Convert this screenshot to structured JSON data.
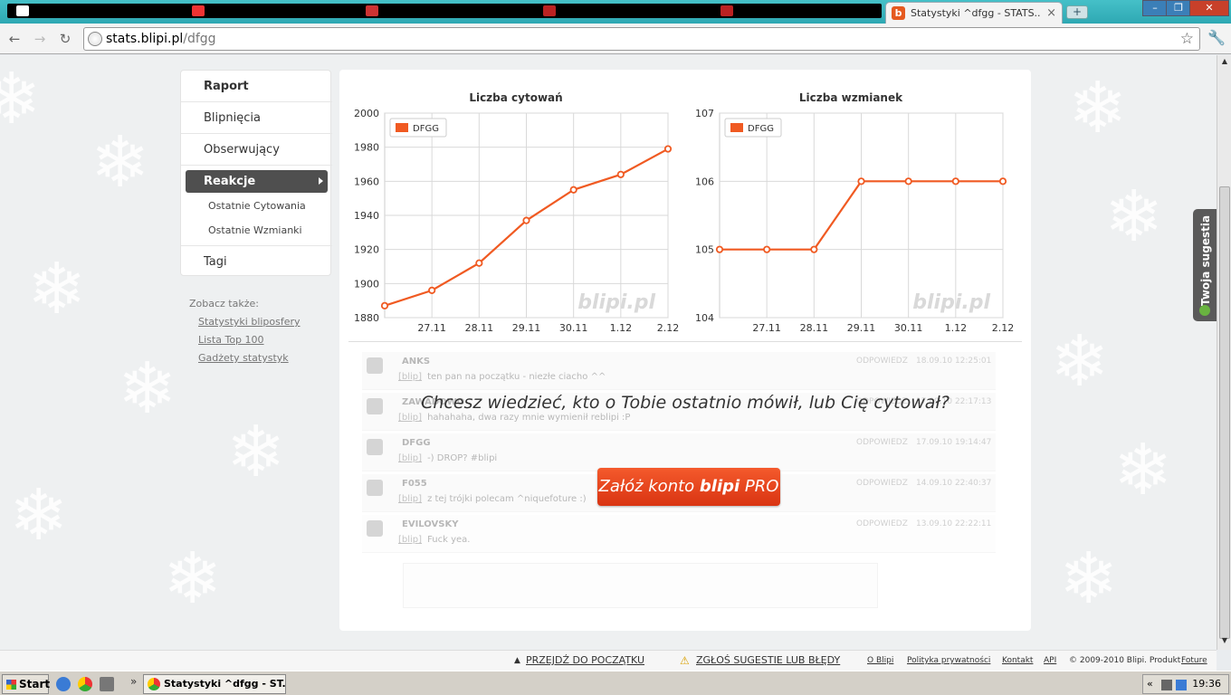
{
  "browser": {
    "active_tab_title": "Statystyki ^dfgg - STATS....",
    "url_host": "stats.blipi.pl",
    "url_path": "/dfgg",
    "new_tab_symbol": "+",
    "close_symbol": "×",
    "back_symbol": "←",
    "forward_symbol": "→",
    "reload_symbol": "↻",
    "star_symbol": "☆",
    "wrench_symbol": "🔧",
    "min_symbol": "–",
    "max_symbol": "❐",
    "win_close_symbol": "✕"
  },
  "sidebar": {
    "items": [
      {
        "label": "Raport",
        "bold": true
      },
      {
        "label": "Blipnięcia"
      },
      {
        "label": "Obserwujący"
      },
      {
        "label": "Reakcje",
        "active": true
      },
      {
        "label": "Tagi"
      }
    ],
    "subitems": [
      "Ostatnie Cytowania",
      "Ostatnie Wzmianki"
    ],
    "see_also_label": "Zobacz także:",
    "see_also_links": [
      "Statystyki bliposfery",
      "Lista Top 100",
      "Gadżety statystyk"
    ]
  },
  "chart_data": [
    {
      "type": "line",
      "title": "Liczba cytowań",
      "x": [
        "27.11",
        "28.11",
        "29.11",
        "30.11",
        "1.12",
        "2.12"
      ],
      "series": [
        {
          "name": "DFGG",
          "values": [
            1887,
            1896,
            1912,
            1937,
            1955,
            1964,
            1979
          ]
        }
      ],
      "point_labels": [
        "",
        "27.11",
        "28.11",
        "29.11",
        "30.11",
        "1.12",
        "2.12"
      ],
      "yticks": [
        1880,
        1900,
        1920,
        1940,
        1960,
        1980,
        2000
      ],
      "ylim": [
        1880,
        2000
      ],
      "color": "#f05a22",
      "watermark": "blipi.pl",
      "legend": "top-left",
      "grid": true
    },
    {
      "type": "line",
      "title": "Liczba wzmianek",
      "x": [
        "27.11",
        "28.11",
        "29.11",
        "30.11",
        "1.12",
        "2.12"
      ],
      "series": [
        {
          "name": "DFGG",
          "values": [
            105,
            105,
            105,
            106,
            106,
            106,
            106
          ]
        }
      ],
      "point_labels": [
        "",
        "27.11",
        "28.11",
        "29.11",
        "30.11",
        "1.12",
        "2.12"
      ],
      "yticks": [
        104,
        105,
        106,
        107
      ],
      "ylim": [
        104,
        107
      ],
      "color": "#f05a22",
      "watermark": "blipi.pl",
      "legend": "top-left",
      "grid": true
    }
  ],
  "feed": [
    {
      "name": "ANKS",
      "tag": "[blip]",
      "text": "ten pan na początku - niezłe ciacho ^^",
      "reply": "ODPOWIEDZ",
      "date": "18.09.10 12:25:01"
    },
    {
      "name": "ZAWADOWO",
      "tag": "[blip]",
      "text": "hahahaha, dwa razy mnie wymienił reblipi :P",
      "reply": "ODPOWIEDZ",
      "date": "17.09.10 22:17:13"
    },
    {
      "name": "DFGG",
      "tag": "[blip]",
      "text": "-) DROP? #blipi",
      "reply": "ODPOWIEDZ",
      "date": "17.09.10 19:14:47"
    },
    {
      "name": "F055",
      "tag": "[blip]",
      "text": "z tej trójki polecam ^niquefoture :)",
      "reply": "ODPOWIEDZ",
      "date": "14.09.10 22:40:37"
    },
    {
      "name": "EVILOVSKY",
      "tag": "[blip]",
      "text": "Fuck yea.",
      "reply": "ODPOWIEDZ",
      "date": "13.09.10 22:22:11"
    }
  ],
  "promo": {
    "headline": "Chcesz wiedzieć, kto o Tobie ostatnio mówił, lub Cię cytował?",
    "btn_prefix": "Załóż konto ",
    "btn_brand": "blipi",
    "btn_suffix": " PRO"
  },
  "suggest_tab": "Twoja sugestia",
  "footer": {
    "top_link": "PRZEJDŹ DO POCZĄTKU",
    "report_link": "ZGŁOŚ SUGESTIE LUB BŁĘDY",
    "links": [
      "O Blipi",
      "Polityka prywatności",
      "Kontakt",
      "API"
    ],
    "copyright": "© 2009-2010 Blipi. Produkt",
    "company": "Foture"
  },
  "taskbar": {
    "start_label": "Start",
    "expand_symbol": "»",
    "task_label": "Statystyki ^dfgg - ST...",
    "tray_arrow": "«",
    "clock": "19:36"
  }
}
